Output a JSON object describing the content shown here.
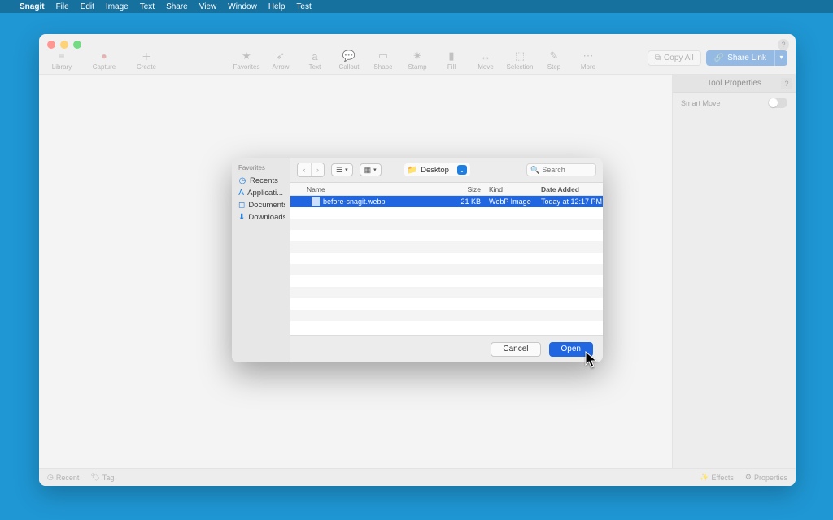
{
  "menubar": {
    "app": "Snagit",
    "items": [
      "File",
      "Edit",
      "Image",
      "Text",
      "Share",
      "View",
      "Window",
      "Help",
      "Test"
    ]
  },
  "toolbar": {
    "left": [
      {
        "icon": "≡",
        "label": "Library"
      },
      {
        "icon": "●",
        "label": "Capture"
      },
      {
        "icon": "＋",
        "label": "Create"
      }
    ],
    "center": [
      {
        "icon": "★",
        "label": "Favorites"
      },
      {
        "icon": "➶",
        "label": "Arrow"
      },
      {
        "icon": "a",
        "label": "Text"
      },
      {
        "icon": "💬",
        "label": "Callout"
      },
      {
        "icon": "▭",
        "label": "Shape"
      },
      {
        "icon": "✷",
        "label": "Stamp"
      },
      {
        "icon": "▮",
        "label": "Fill"
      },
      {
        "icon": "↔",
        "label": "Move"
      },
      {
        "icon": "⬚",
        "label": "Selection"
      },
      {
        "icon": "✎",
        "label": "Step"
      }
    ],
    "more_label": "More",
    "copy_label": "Copy All",
    "share_label": "Share Link"
  },
  "props": {
    "title": "Tool Properties",
    "smart_move": "Smart Move"
  },
  "statusbar": {
    "recent": "Recent",
    "tag": "Tag",
    "effects": "Effects",
    "properties": "Properties"
  },
  "sheet": {
    "favorites_header": "Favorites",
    "favorites": [
      "Recents",
      "Applicati...",
      "Documents",
      "Downloads"
    ],
    "location": "Desktop",
    "search_placeholder": "Search",
    "columns": {
      "name": "Name",
      "size": "Size",
      "kind": "Kind",
      "date": "Date Added"
    },
    "rows": [
      {
        "name": "before-snagit.webp",
        "size": "21 KB",
        "kind": "WebP Image",
        "date": "Today at 12:17 PM",
        "selected": true
      }
    ],
    "cancel": "Cancel",
    "open": "Open"
  }
}
